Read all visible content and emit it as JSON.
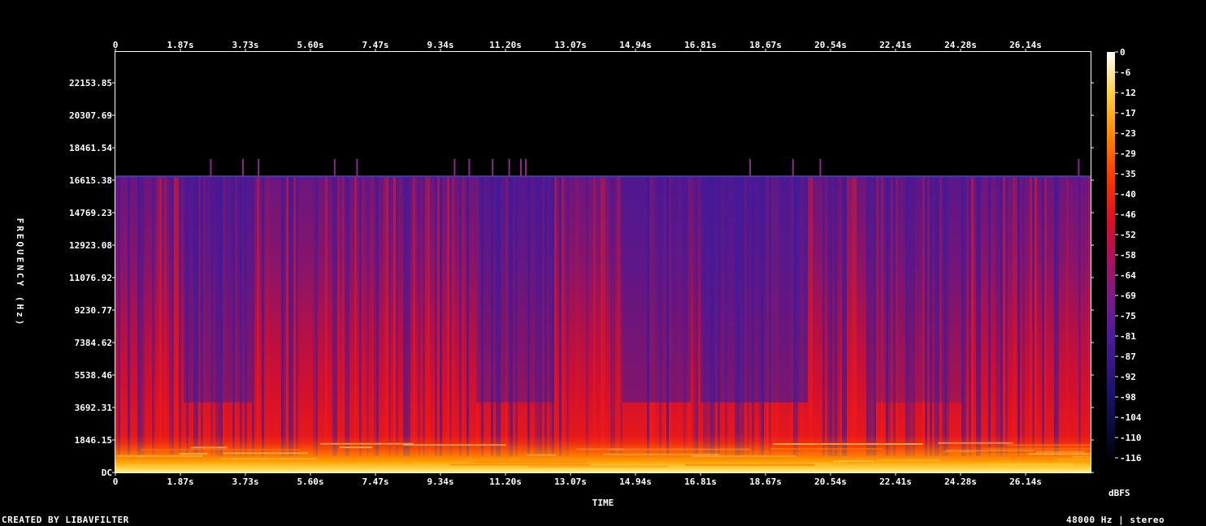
{
  "footer": {
    "credit": "CREATED BY LIBAVFILTER",
    "format": "48000 Hz | stereo"
  },
  "chart_data": {
    "type": "heatmap",
    "title": "",
    "xlabel": "TIME",
    "ylabel": "FREQUENCY (Hz)",
    "colorbar_label": "dBFS",
    "x_ticks": [
      "0",
      "1.87s",
      "3.73s",
      "5.60s",
      "7.47s",
      "9.34s",
      "11.20s",
      "13.07s",
      "14.94s",
      "16.81s",
      "18.67s",
      "20.54s",
      "22.41s",
      "24.28s",
      "26.14s"
    ],
    "y_ticks": [
      "DC",
      "1846.15",
      "3692.31",
      "5538.46",
      "7384.62",
      "9230.77",
      "11076.92",
      "12923.08",
      "14769.23",
      "16615.38",
      "18461.54",
      "20307.69",
      "22153.85"
    ],
    "colorbar_ticks": [
      "0",
      "-6",
      "-12",
      "-17",
      "-23",
      "-29",
      "-35",
      "-40",
      "-46",
      "-52",
      "-58",
      "-64",
      "-69",
      "-75",
      "-81",
      "-87",
      "-92",
      "-98",
      "-104",
      "-110",
      "-116"
    ],
    "x_range": [
      0,
      28.0
    ],
    "y_range": [
      0,
      24000
    ],
    "z_range_dbfs": [
      -120,
      0
    ],
    "content_cutoff_hz": 16900,
    "colormap": [
      "#000000",
      "#1a0a5a",
      "#4a1a9a",
      "#7a1a8a",
      "#c0104a",
      "#e81010",
      "#ff6000",
      "#ffb000",
      "#ffe860",
      "#ffffff"
    ]
  }
}
